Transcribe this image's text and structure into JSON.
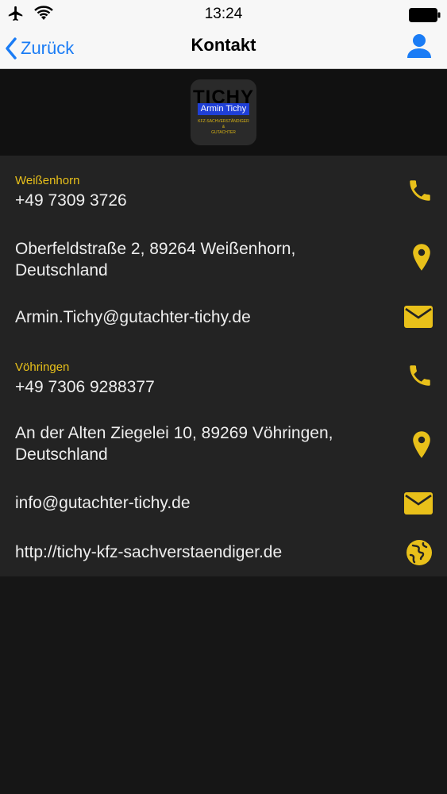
{
  "status_bar": {
    "time": "13:24",
    "icons": [
      "airplane-icon",
      "wifi-icon",
      "battery-icon"
    ]
  },
  "nav": {
    "back_label": "Zurück",
    "title": "Kontakt",
    "right_icon": "person-icon"
  },
  "logo": {
    "brand": "TICHY",
    "name": "Armin Tichy",
    "subtitle_lines": [
      "KFZ-SACHVERSTÄNDIGER",
      "&",
      "GUTACHTER"
    ]
  },
  "contacts": [
    {
      "location": "Weißenhorn",
      "phone": "+49 7309 3726",
      "phone_icon": "phone-icon"
    },
    {
      "address": "Oberfeldstraße 2, 89264 Weißenhorn, Deutschland",
      "address_icon": "location-pin-icon"
    },
    {
      "email": "Armin.Tichy@gutachter-tichy.de",
      "email_icon": "mail-icon"
    },
    {
      "location": "Vöhringen",
      "phone": "+49 7306 9288377",
      "phone_icon": "phone-icon"
    },
    {
      "address": "An der Alten Ziegelei 10, 89269 Vöhringen, Deutschland",
      "address_icon": "location-pin-icon"
    },
    {
      "email": "info@gutachter-tichy.de",
      "email_icon": "mail-icon"
    },
    {
      "url": "http://tichy-kfz-sachverstaendiger.de",
      "url_icon": "globe-icon"
    }
  ],
  "colors": {
    "accent": "#e8c01a",
    "ios_blue": "#1a7cf5",
    "background": "#161616",
    "list_background": "#232323",
    "text": "#eeeeee"
  }
}
